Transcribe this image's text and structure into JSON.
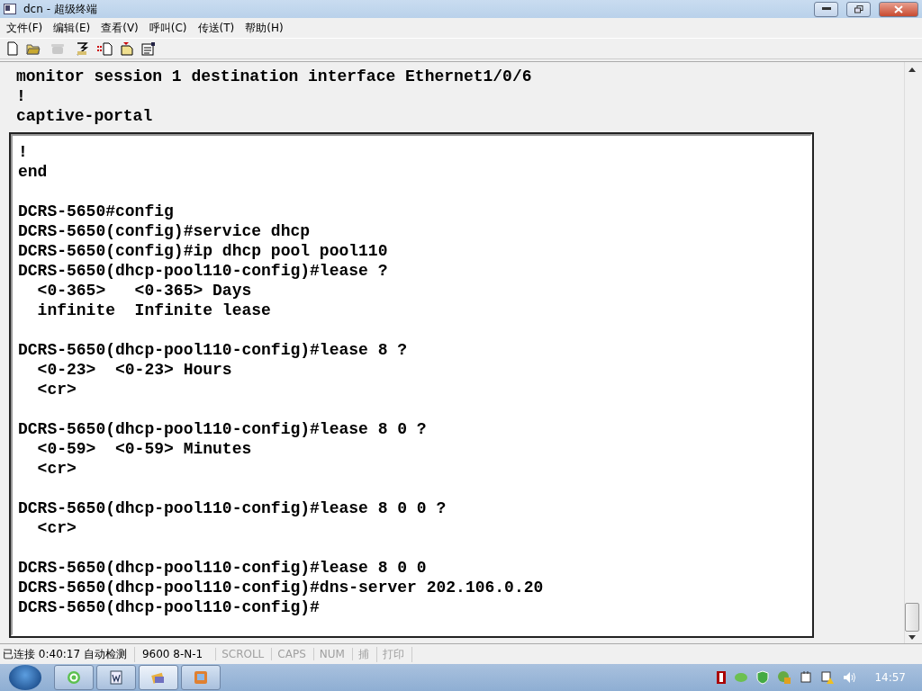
{
  "window": {
    "title": "dcn - 超级终端"
  },
  "menu": [
    "文件(F)",
    "编辑(E)",
    "查看(V)",
    "呼叫(C)",
    "传送(T)",
    "帮助(H)"
  ],
  "toolbar": [
    {
      "kind": "new",
      "disabled": false
    },
    {
      "kind": "open",
      "disabled": false
    },
    {
      "kind": "call",
      "disabled": true
    },
    {
      "kind": "hangup",
      "disabled": false
    },
    {
      "kind": "send",
      "disabled": false
    },
    {
      "kind": "receive",
      "disabled": false
    },
    {
      "kind": "properties",
      "disabled": false
    }
  ],
  "terminal": {
    "scrollback": [
      "monitor session 1 destination interface Ethernet1/0/6",
      "!",
      "captive-portal"
    ],
    "blocks": [
      [
        "!",
        "end"
      ],
      [
        "DCRS-5650#config",
        "DCRS-5650(config)#service dhcp",
        "DCRS-5650(config)#ip dhcp pool pool110",
        "DCRS-5650(dhcp-pool110-config)#lease ?",
        "  <0-365>   <0-365> Days",
        "  infinite  Infinite lease"
      ],
      [
        "DCRS-5650(dhcp-pool110-config)#lease 8 ?",
        "  <0-23>  <0-23> Hours",
        "  <cr>"
      ],
      [
        "DCRS-5650(dhcp-pool110-config)#lease 8 0 ?",
        "  <0-59>  <0-59> Minutes",
        "  <cr>"
      ],
      [
        "DCRS-5650(dhcp-pool110-config)#lease 8 0 0 ?",
        "  <cr>"
      ],
      [
        "DCRS-5650(dhcp-pool110-config)#lease 8 0 0",
        "DCRS-5650(dhcp-pool110-config)#dns-server 202.106.0.20",
        "DCRS-5650(dhcp-pool110-config)#"
      ]
    ]
  },
  "status_bar": {
    "connection": "已连接 0:40:17 自动检测",
    "settings": "9600 8-N-1",
    "indicators": [
      {
        "label": "SCROLL",
        "on": false
      },
      {
        "label": "CAPS",
        "on": false
      },
      {
        "label": "NUM",
        "on": false
      },
      {
        "label": "捕",
        "on": false
      },
      {
        "label": "打印",
        "on": false
      }
    ]
  },
  "taskbar": {
    "buttons": [
      {
        "kind": "browser",
        "selected": false
      },
      {
        "kind": "word",
        "selected": false
      },
      {
        "kind": "terminal",
        "selected": true
      },
      {
        "kind": "app",
        "selected": false
      }
    ],
    "clock": "14:57"
  }
}
